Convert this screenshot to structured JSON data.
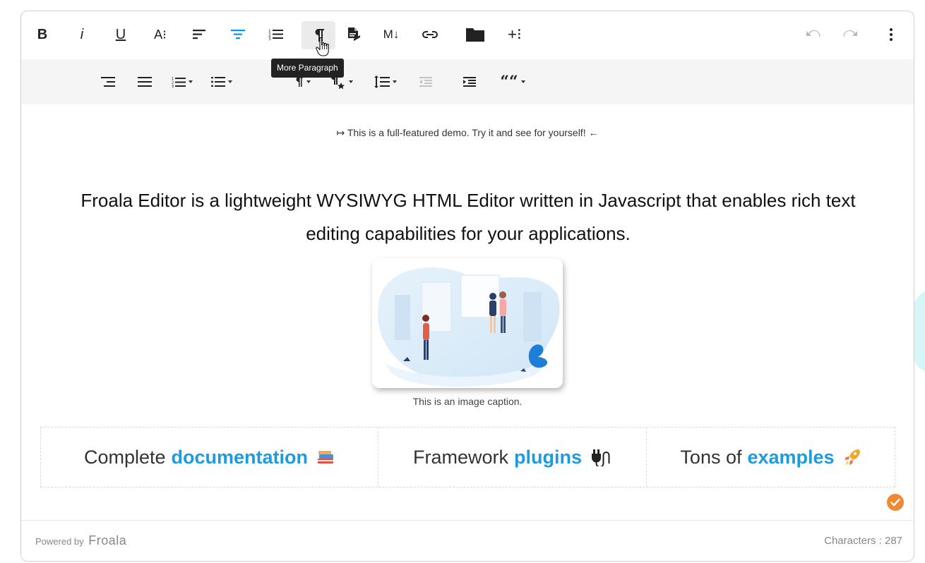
{
  "toolbar": {
    "bold_label": "B",
    "italic_label": "i",
    "underline_label": "U",
    "font_size_label": "A⁝",
    "markdown_label": "M↓",
    "more_label": "+⁝",
    "tooltip": "More Paragraph",
    "quote_label": "““"
  },
  "content": {
    "demo_note": "↦ This is a full-featured demo. Try it and see for yourself! ←",
    "intro": "Froala Editor is a lightweight WYSIWYG HTML Editor written in Javascript that enables rich text editing capabilities for your applications.",
    "caption": "This is an image caption.",
    "features": [
      {
        "prefix": "Complete",
        "link": "documentation",
        "icon": "books-icon"
      },
      {
        "prefix": "Framework",
        "link": "plugins",
        "icon": "plug-icon"
      },
      {
        "prefix": "Tons of",
        "link": "examples",
        "icon": "rocket-icon"
      }
    ]
  },
  "footer": {
    "powered_prefix": "Powered by",
    "brand": "Froala",
    "characters": "Characters : 287"
  },
  "colors": {
    "accent": "#0098f7",
    "link": "#1e9ae0",
    "check": "#ef8a34"
  }
}
